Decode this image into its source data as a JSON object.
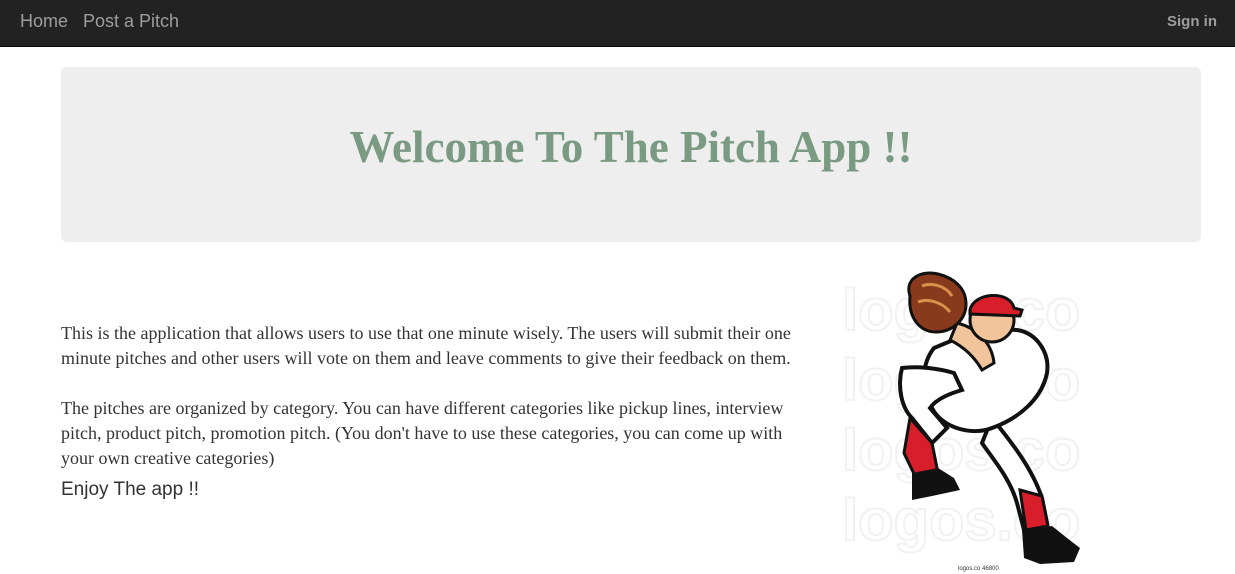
{
  "navbar": {
    "home_label": "Home",
    "post_label": "Post a Pitch",
    "signin_label": "Sign in"
  },
  "hero": {
    "title": "Welcome To The Pitch App !!"
  },
  "main": {
    "paragraph1": "This is the application that allows users to use that one minute wisely. The users will submit their one minute pitches and other users will vote on them and leave comments to give their feedback on them.",
    "paragraph2": "The pitches are organized by category. You can have different categories like pickup lines, interview pitch, product pitch, promotion pitch. (You don't have to use these categories, you can come up with your own creative categories)",
    "enjoy": "Enjoy The app !!"
  },
  "illustration": {
    "subject": "baseball-pitcher-cartoon",
    "watermark": "logos.co",
    "caption": "logos.co    46800"
  },
  "colors": {
    "navbar_bg": "#222222",
    "nav_text": "#9d9d9d",
    "jumbotron_bg": "#eeeeee",
    "title": "#7a9a82",
    "body_text": "#333333"
  }
}
